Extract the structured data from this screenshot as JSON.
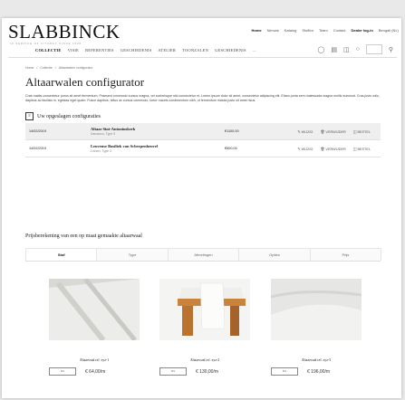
{
  "brand": {
    "logo": "SLABBINCK",
    "tagline": "IN SERVICE OF LITURGY SINCE 1928"
  },
  "topnav": [
    "Home",
    "Nieuws",
    "Katalog",
    "Stoffen",
    "Team",
    "Contact",
    "Dealer log-in",
    "Bengali (NL)"
  ],
  "mainnav": [
    "COLLECTIE",
    "VISIE",
    "REFERENTIES",
    "GESCHIEDENIS",
    "ATELIER",
    "TOONZALEN",
    "GESCHIEDENIS",
    "..."
  ],
  "breadcrumb": [
    "Home",
    "/",
    "Collectie",
    "/",
    "Altaarwalen configurator"
  ],
  "title": "Altaarwalen configurator",
  "intro": "Cras mattis consectetur purus sit amet fermentum. Praesent commodo cursus magna, vel scelerisque nisl consectetur et. Lorem ipsum dolor sit amet, consectetur adipiscing elit. Etiam porta sem malesuada magna mollis euismod. Cras justo odio, dapibus ac facilisis in, egestas eget quam. Fusce dapibus, tellus ac cursus commodo, tortor mauris condimentum nibh, ut fermentum massa justo sit amet risus.",
  "saved": {
    "heading": "Uw opgeslagen configuraties",
    "rows": [
      {
        "date": "14/02/2019",
        "name": "Altaar Sint-Antoniuskerk",
        "sub": "Damasco, Type 5",
        "price": "€1100,00",
        "actions": [
          "WIJZIG",
          "VERWIJDER",
          "BESTEL"
        ]
      },
      {
        "date": "14/02/2019",
        "name": "Leuvense Basiliek van Scherpenheuvel",
        "sub": "Linnen, Type 3",
        "price": "€500,00",
        "actions": [
          "WIJZIG",
          "VERWIJDER",
          "BESTEL"
        ]
      }
    ]
  },
  "pricing": {
    "heading": "Prijsberekening van een op maat gemaakte altaarwaal",
    "tabs": [
      "Stof",
      "Type",
      "Afmetingen",
      "Opties",
      "Prijs"
    ]
  },
  "products": [
    {
      "name": "Altaarwaal ref. xyz-1",
      "qty": "M1",
      "price": "€ 64,00/m"
    },
    {
      "name": "Altaarwaal ref. xyz-2",
      "qty": "M1",
      "price": "€ 130,00/m"
    },
    {
      "name": "Altaarwaal ref. xyz-3",
      "qty": "M1",
      "price": "€ 196,00/m"
    }
  ],
  "icons": {
    "search": "search-icon",
    "user": "user-icon",
    "cart": "cart-icon",
    "chat": "chat-icon"
  }
}
